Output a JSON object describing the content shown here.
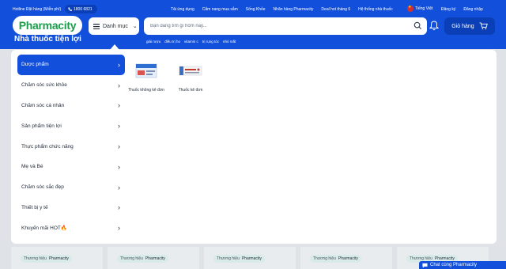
{
  "topbar": {
    "hotline": "Hotline Đặt hàng (Miễn phí)",
    "phone": "1800 6821",
    "links": [
      "Tải ứng dụng",
      "Cẩm nang mua sắm",
      "Sống Khỏe",
      "Nhãn hàng Pharmacity",
      "Deal hot tháng 6",
      "Hệ thống nhà thuốc"
    ],
    "language": "Tiếng Việt",
    "register": "Đăng ký",
    "login": "Đăng nhập"
  },
  "brand": {
    "logo": "Pharmacity",
    "slogan": "Nhà thuốc tiện lợi"
  },
  "category_button": {
    "label": "Danh mục"
  },
  "search": {
    "placeholder": "Bạn đang tìm gì hôm nay...",
    "suggestions": [
      "giải rượu",
      "điều trị ho",
      "vitamin c",
      "trị rụng tóc",
      "nhỏ mắt"
    ]
  },
  "cart": {
    "label": "Giỏ hàng"
  },
  "menu": {
    "items": [
      {
        "label": "Dược phẩm",
        "active": true
      },
      {
        "label": "Chăm sóc sức khỏe"
      },
      {
        "label": "Chăm sóc cá nhân"
      },
      {
        "label": "Sản phẩm tiện lợi"
      },
      {
        "label": "Thực phẩm chức năng"
      },
      {
        "label": "Mẹ và Bé"
      },
      {
        "label": "Chăm sóc sắc đẹp"
      },
      {
        "label": "Thiết bị y tế"
      },
      {
        "label": "Khuyến mãi HOT🔥"
      }
    ]
  },
  "subcategories": [
    {
      "label": "Thuốc không kê đơn",
      "thumb_text": "EFFERALGAN"
    },
    {
      "label": "Thuốc kê đơn"
    }
  ],
  "background_cards": {
    "brand_label": "Thương hiệu",
    "brand_name": "Pharmacity"
  },
  "chat": {
    "label": "Chat cùng Pharmacity"
  },
  "colors": {
    "primary": "#1250dc",
    "dark_primary": "#0a3fb8",
    "logo_green": "#1a9e4b"
  }
}
